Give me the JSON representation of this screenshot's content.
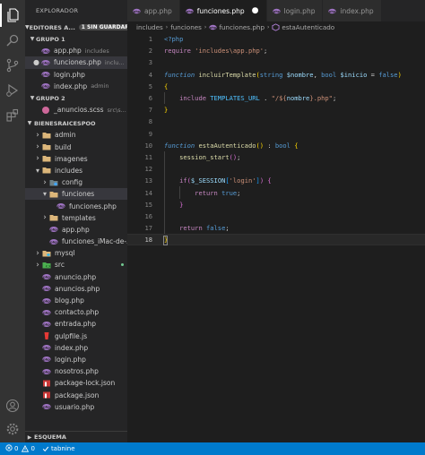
{
  "activity_bar": {
    "icons": [
      "files-icon",
      "search-icon",
      "source-control-icon",
      "run-debug-icon",
      "extensions-icon"
    ],
    "bottom_icons": [
      "account-icon",
      "settings-gear-icon"
    ]
  },
  "sidebar": {
    "title": "EXPLORADOR",
    "open_editors": {
      "label": "EDITORES A...",
      "badge": "1 SIN GUARDAR",
      "groups": [
        {
          "label": "GRUPO 1",
          "files": [
            {
              "name": "app.php",
              "desc": "includes",
              "dirty": false,
              "selected": false
            },
            {
              "name": "funciones.php",
              "desc": "inclu...",
              "dirty": true,
              "selected": true
            },
            {
              "name": "login.php",
              "desc": "",
              "dirty": false,
              "selected": false
            },
            {
              "name": "index.php",
              "desc": "admin",
              "dirty": false,
              "selected": false
            }
          ]
        },
        {
          "label": "GRUPO 2",
          "files": [
            {
              "name": "_anuncios.scss",
              "desc": "src\\s...",
              "dirty": false,
              "selected": false
            }
          ]
        }
      ]
    },
    "project": {
      "label": "BIENESRAICESPOO",
      "tree": [
        {
          "name": "admin",
          "kind": "folder",
          "open": false,
          "depth": 0
        },
        {
          "name": "build",
          "kind": "folder",
          "open": false,
          "depth": 0
        },
        {
          "name": "imagenes",
          "kind": "folder",
          "open": false,
          "depth": 0
        },
        {
          "name": "includes",
          "kind": "folder",
          "open": true,
          "depth": 0
        },
        {
          "name": "config",
          "kind": "config-folder",
          "open": false,
          "depth": 1
        },
        {
          "name": "funciones",
          "kind": "folder",
          "open": true,
          "depth": 1,
          "selected": true
        },
        {
          "name": "funciones.php",
          "kind": "php",
          "depth": 2
        },
        {
          "name": "templates",
          "kind": "folder",
          "open": false,
          "depth": 1
        },
        {
          "name": "app.php",
          "kind": "php",
          "depth": 1
        },
        {
          "name": "funciones_iMac-de-...",
          "kind": "php",
          "depth": 1
        },
        {
          "name": "mysql",
          "kind": "db-folder",
          "open": false,
          "depth": 0
        },
        {
          "name": "src",
          "kind": "src-folder",
          "open": false,
          "depth": 0,
          "git_dot": true
        },
        {
          "name": "anuncio.php",
          "kind": "php",
          "depth": 0
        },
        {
          "name": "anuncios.php",
          "kind": "php",
          "depth": 0
        },
        {
          "name": "blog.php",
          "kind": "php",
          "depth": 0
        },
        {
          "name": "contacto.php",
          "kind": "php",
          "depth": 0
        },
        {
          "name": "entrada.php",
          "kind": "php",
          "depth": 0
        },
        {
          "name": "gulpfile.js",
          "kind": "gulp",
          "depth": 0
        },
        {
          "name": "index.php",
          "kind": "php",
          "depth": 0
        },
        {
          "name": "login.php",
          "kind": "php",
          "depth": 0
        },
        {
          "name": "nosotros.php",
          "kind": "php",
          "depth": 0
        },
        {
          "name": "package-lock.json",
          "kind": "npm",
          "depth": 0
        },
        {
          "name": "package.json",
          "kind": "npm",
          "depth": 0
        },
        {
          "name": "usuario.php",
          "kind": "php",
          "depth": 0
        }
      ]
    },
    "outline_label": "ESQUEMA"
  },
  "tabs": [
    {
      "label": "app.php",
      "active": false,
      "dirty": false
    },
    {
      "label": "funciones.php",
      "active": true,
      "dirty": true
    },
    {
      "label": "login.php",
      "active": false,
      "dirty": false
    },
    {
      "label": "index.php",
      "active": false,
      "dirty": false
    }
  ],
  "breadcrumb": [
    "includes",
    "funciones",
    "funciones.php",
    "estaAutenticado"
  ],
  "editor": {
    "current_line": 18,
    "lines": [
      {
        "n": 1,
        "tokens": [
          [
            "tag",
            "<?php"
          ]
        ]
      },
      {
        "n": 2,
        "tokens": [
          [
            "kw",
            "require "
          ],
          [
            "str",
            "'includes\\app.php'"
          ],
          [
            "op",
            ";"
          ]
        ]
      },
      {
        "n": 3,
        "tokens": []
      },
      {
        "n": 4,
        "tokens": [
          [
            "type it",
            "function "
          ],
          [
            "fn",
            "incluirTemplate"
          ],
          [
            "br1",
            "("
          ],
          [
            "type",
            "string "
          ],
          [
            "var",
            "$nombre"
          ],
          [
            "op",
            ", "
          ],
          [
            "type",
            "bool "
          ],
          [
            "var",
            "$inicio"
          ],
          [
            "op",
            " = "
          ],
          [
            "type",
            "false"
          ],
          [
            "br1",
            ")"
          ]
        ]
      },
      {
        "n": 5,
        "tokens": [
          [
            "br1",
            "{"
          ]
        ]
      },
      {
        "n": 6,
        "indent": 1,
        "tokens": [
          [
            "kw",
            "include "
          ],
          [
            "const",
            "TEMPLATES_URL"
          ],
          [
            "op",
            " . "
          ],
          [
            "str",
            "\"/${"
          ],
          [
            "var",
            "nombre"
          ],
          [
            "str",
            "}.php\""
          ],
          [
            "op",
            ";"
          ]
        ]
      },
      {
        "n": 7,
        "tokens": [
          [
            "br1",
            "}"
          ]
        ]
      },
      {
        "n": 8,
        "tokens": []
      },
      {
        "n": 9,
        "tokens": []
      },
      {
        "n": 10,
        "tokens": [
          [
            "type it",
            "function "
          ],
          [
            "fn",
            "estaAutenticado"
          ],
          [
            "br1",
            "()"
          ],
          [
            "op",
            " : "
          ],
          [
            "type",
            "bool "
          ],
          [
            "br1",
            "{"
          ]
        ]
      },
      {
        "n": 11,
        "indent": 1,
        "tokens": [
          [
            "fn",
            "session_start"
          ],
          [
            "br2",
            "()"
          ],
          [
            "op",
            ";"
          ]
        ]
      },
      {
        "n": 12,
        "tokens": []
      },
      {
        "n": 13,
        "indent": 1,
        "tokens": [
          [
            "kw",
            "if"
          ],
          [
            "br2",
            "("
          ],
          [
            "var",
            "$_SESSION"
          ],
          [
            "br3",
            "["
          ],
          [
            "str",
            "'login'"
          ],
          [
            "br3",
            "]"
          ],
          [
            "br2",
            ")"
          ],
          [
            "op",
            " "
          ],
          [
            "br2",
            "{"
          ]
        ]
      },
      {
        "n": 14,
        "indent": 2,
        "tokens": [
          [
            "kw",
            "return "
          ],
          [
            "type",
            "true"
          ],
          [
            "op",
            ";"
          ]
        ]
      },
      {
        "n": 15,
        "indent": 1,
        "tokens": [
          [
            "br2",
            "}"
          ]
        ]
      },
      {
        "n": 16,
        "tokens": []
      },
      {
        "n": 17,
        "indent": 1,
        "tokens": [
          [
            "kw",
            "return "
          ],
          [
            "type",
            "false"
          ],
          [
            "op",
            ";"
          ]
        ]
      },
      {
        "n": 18,
        "tokens": [
          [
            "br1",
            "}"
          ]
        ]
      }
    ]
  },
  "statusbar": {
    "errors": "0",
    "warnings": "0",
    "tabnine": "tabnine"
  },
  "colors": {
    "accent": "#007acc",
    "sidebar_bg": "#252526",
    "editor_bg": "#1e1e1e",
    "php_icon": "#a074c4",
    "folder": "#dcb67a"
  }
}
